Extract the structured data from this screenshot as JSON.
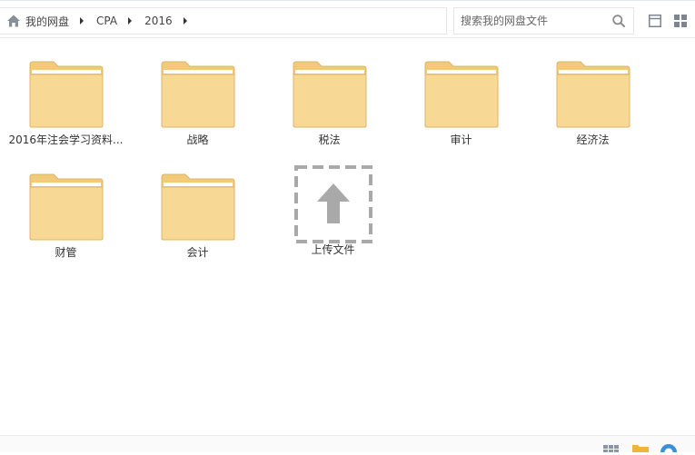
{
  "breadcrumb": {
    "home_label": "我的网盘",
    "items": [
      "CPA",
      "2016"
    ]
  },
  "search": {
    "placeholder": "搜索我的网盘文件"
  },
  "folders": [
    {
      "name": "2016年注会学习资料..."
    },
    {
      "name": "战略"
    },
    {
      "name": "税法"
    },
    {
      "name": "审计"
    },
    {
      "name": "经济法"
    },
    {
      "name": "财管"
    },
    {
      "name": "会计"
    }
  ],
  "upload": {
    "label": "上传文件"
  },
  "colors": {
    "folder_body": "#f7d895",
    "folder_tab": "#f1ca7a",
    "folder_edge": "#dcb467",
    "icon_gray": "#9a9a9a",
    "home_icon": "#8a8f97",
    "view_icon": "#7c8591"
  },
  "icons": {
    "home": "home-icon",
    "search": "search-icon",
    "list_view": "list-view-icon",
    "grid_view": "grid-view-icon",
    "folder": "folder-icon",
    "upload": "upload-arrow-icon"
  }
}
